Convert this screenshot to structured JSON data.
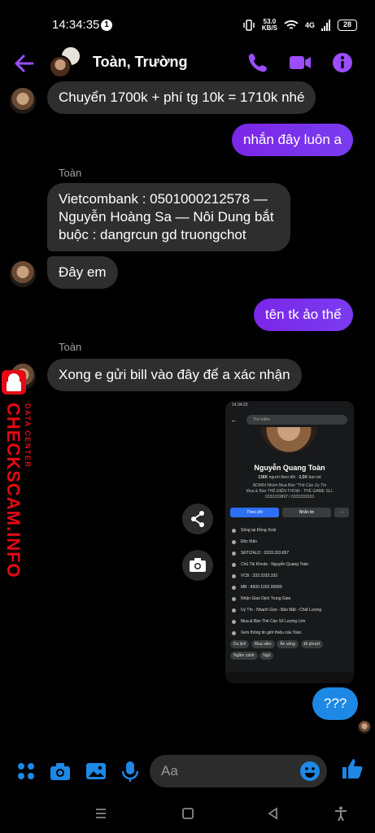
{
  "status": {
    "time": "14:34:35",
    "notif_count": "1",
    "speed_value": "53.0",
    "speed_unit": "KB/S",
    "network": "4G",
    "battery": "28"
  },
  "header": {
    "title": "Toàn, Trường"
  },
  "messages": {
    "m1": "Chuyển 1700k + phí tg 10k = 1710k nhé",
    "m2": "nhắn đây luôn a",
    "sender1": "Toàn",
    "m3_line1": "Vietcombank  :  0501000212578  —",
    "m3_line2": "Nguyễn Hoàng Sa —    Nôi Dung bắt",
    "m3_line3": "buộc : dangrcun gd truongchot",
    "m4": "Đây em",
    "m5": "tên tk ảo thế",
    "sender2": "Toàn",
    "m6": "Xong e gửi bill vào đây để a xác nhận",
    "m7": "???"
  },
  "shot": {
    "time": "14:34:23",
    "search_placeholder": "Tìm kiếm",
    "name": "Nguyễn Quang Toàn",
    "follow_count": "138K",
    "follow_label": "người theo dõi",
    "friends_count": "2,5K",
    "friends_label": "bạn bè",
    "bio1": "ADMIN Nhóm Mua Bán \"Thẻ Cào Uy Tín",
    "bio2": "Mua & Bán THẺ ĐIỆN THOẠI - THẺ GAME SLL",
    "bio3": "0333333897 / 0333333333",
    "btn_follow": "Theo dõi",
    "btn_message": "Nhắn tin",
    "btn_more": "···",
    "rows": [
      "Sống tại Đồng Xoài",
      "Độc thân",
      "SĐT/ZALO : 0333.333.897",
      "Chủ Tài Khoản : Nguyễn Quang Toàn",
      "VCB : 333.3333.333",
      "MB : 8600.1002.99999",
      "Nhận Giao Dịch Trung Gian",
      "Uy Tín - Nhanh Gọn - Bảo Mật - Chất Lượng",
      "Mua & Bán Thẻ Cào Số Lượng Lớn",
      "Xem thông tin giới thiệu của Toàn"
    ],
    "chips": [
      "Du lịch",
      "Mua sắm",
      "Ăn uống",
      "Đi phượt",
      "Ngắm cảnh",
      "Ngủ"
    ]
  },
  "watermark": {
    "main": "CHECKSCAM.INFO",
    "sub": "DATA CENTER"
  },
  "composer": {
    "placeholder": "Aa"
  },
  "colors": {
    "accent": "#8a2be2",
    "incoming": "#2e2e2e",
    "messenger_blue": "#1e88e5",
    "watermark_red": "#e50914"
  }
}
